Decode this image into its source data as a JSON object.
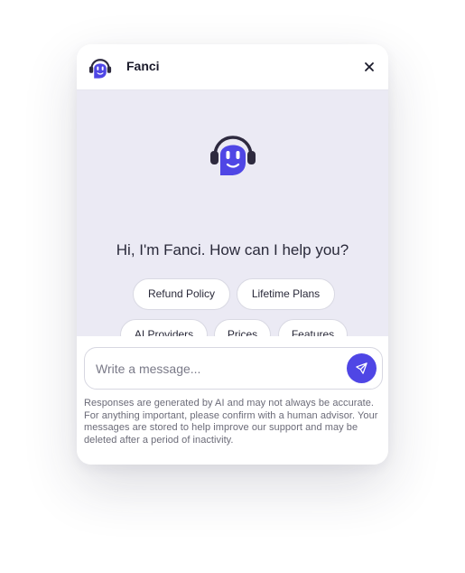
{
  "header": {
    "title": "Fanci",
    "close_label": "×"
  },
  "hero": {
    "greeting": "Hi, I'm Fanci. How can I help you?"
  },
  "suggestions": [
    "Refund Policy",
    "Lifetime Plans",
    "AI Providers",
    "Prices",
    "Features"
  ],
  "composer": {
    "placeholder": "Write a message...",
    "value": "",
    "disclaimer": "Responses are generated by AI and may not always be accurate. For anything important, please confirm with a human advisor. Your messages are stored to help improve our support and may be deleted after a period of inactivity."
  },
  "icons": {
    "avatar": "robot-headset-icon",
    "close": "close-icon",
    "send": "send-icon"
  },
  "colors": {
    "brand": "#4f46e5",
    "hero_bg": "#ebeaf4",
    "headset": "#2e2a3f"
  }
}
